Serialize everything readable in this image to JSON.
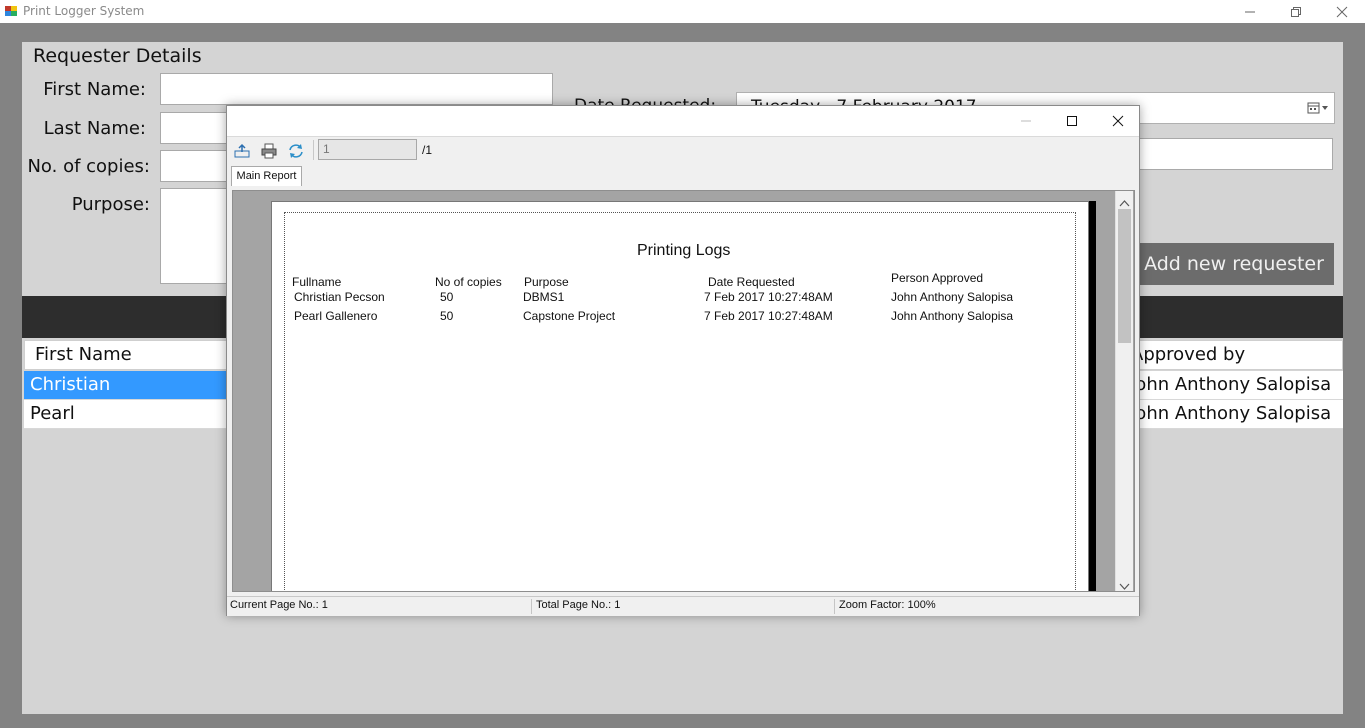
{
  "app": {
    "title": "Print Logger System"
  },
  "form": {
    "heading": "Requester Details",
    "first_name_label": "First Name:",
    "last_name_label": "Last Name:",
    "copies_label": "No. of copies:",
    "purpose_label": "Purpose:",
    "date_label": "Date Requested:",
    "date_value": "Tuesday  ,  7  February  2017",
    "add_button": "Add new requester"
  },
  "grid": {
    "col_first_name": "First Name",
    "col_approved_by": "Approved by",
    "rows": [
      {
        "first_name": "Christian",
        "approved_by": "John Anthony Salopisa",
        "selected": true
      },
      {
        "first_name": "Pearl",
        "approved_by": "John Anthony Salopisa",
        "selected": false
      }
    ]
  },
  "viewer": {
    "page_input": "1",
    "page_total": "/1",
    "tab_label": "Main Report",
    "status": {
      "current_page": "Current Page No.: 1",
      "total_page": "Total Page No.: 1",
      "zoom": "Zoom Factor: 100%"
    }
  },
  "report": {
    "title": "Printing Logs",
    "headers": {
      "fullname": "Fullname",
      "copies": "No of copies",
      "purpose": "Purpose",
      "date": "Date Requested",
      "approved": "Person Approved"
    },
    "rows": [
      {
        "fullname": "Christian Pecson",
        "copies": "50",
        "purpose": "DBMS1",
        "date": "7 Feb 2017  10:27:48AM",
        "approved": "John Anthony Salopisa"
      },
      {
        "fullname": "Pearl Gallenero",
        "copies": "50",
        "purpose": "Capstone Project",
        "date": "7 Feb 2017  10:27:48AM",
        "approved": "John Anthony Salopisa"
      }
    ]
  },
  "colors": {
    "selection": "#3399ff",
    "button": "#6c6c6c",
    "band": "#2d2d2d"
  }
}
